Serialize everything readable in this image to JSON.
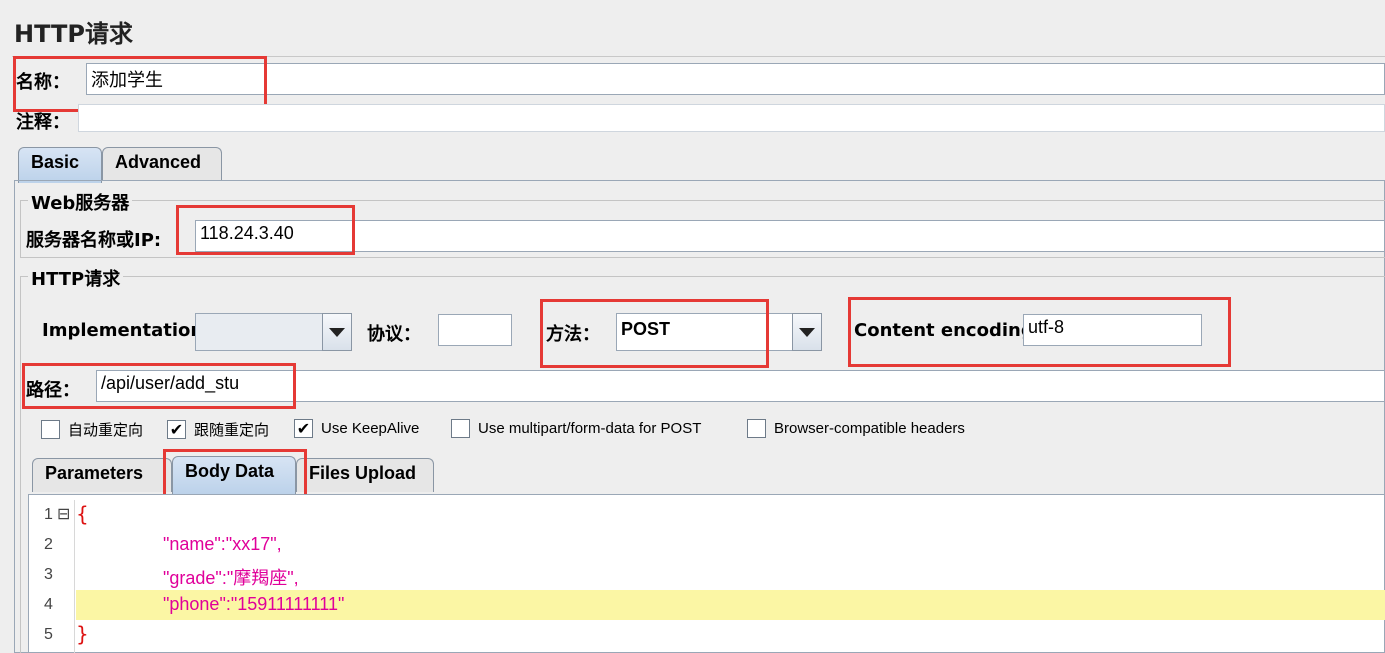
{
  "page": {
    "title": "HTTP请求"
  },
  "name_field": {
    "label": "名称：",
    "value": "添加学生"
  },
  "comment_field": {
    "label": "注释：",
    "value": ""
  },
  "main_tabs": [
    {
      "label": "Basic",
      "active": true
    },
    {
      "label": "Advanced",
      "active": false
    }
  ],
  "web_server": {
    "group_title": "Web服务器",
    "server_label": "服务器名称或IP:",
    "server_value": "118.24.3.40"
  },
  "http_request": {
    "group_title": "HTTP请求",
    "implementation_label": "Implementation:",
    "implementation_value": "",
    "protocol_label": "协议：",
    "protocol_value": "",
    "method_label": "方法：",
    "method_value": "POST",
    "encoding_label": "Content encoding:",
    "encoding_value": "utf-8",
    "path_label": "路径：",
    "path_value": "/api/user/add_stu"
  },
  "options": [
    {
      "label": "自动重定向",
      "checked": false
    },
    {
      "label": "跟随重定向",
      "checked": true
    },
    {
      "label": "Use KeepAlive",
      "checked": true
    },
    {
      "label": "Use multipart/form-data for POST",
      "checked": false
    },
    {
      "label": "Browser-compatible headers",
      "checked": false
    }
  ],
  "sub_tabs": [
    {
      "label": "Parameters",
      "active": false
    },
    {
      "label": "Body Data",
      "active": true
    },
    {
      "label": "Files Upload",
      "active": false
    }
  ],
  "body_data": {
    "line_numbers": [
      "1",
      "2",
      "3",
      "4",
      "5"
    ],
    "lines": [
      "{",
      "\"name\":\"xx17\",",
      "\"grade\":\"摩羯座\",",
      "\"phone\":\"15911111111\"",
      "}"
    ],
    "fold_icon": "⊟",
    "highlight_line": 4
  },
  "colors": {
    "highlight": "#fbf6a4",
    "string": "#e0009a",
    "brace": "#dd1111",
    "annotation": "#e53935"
  }
}
